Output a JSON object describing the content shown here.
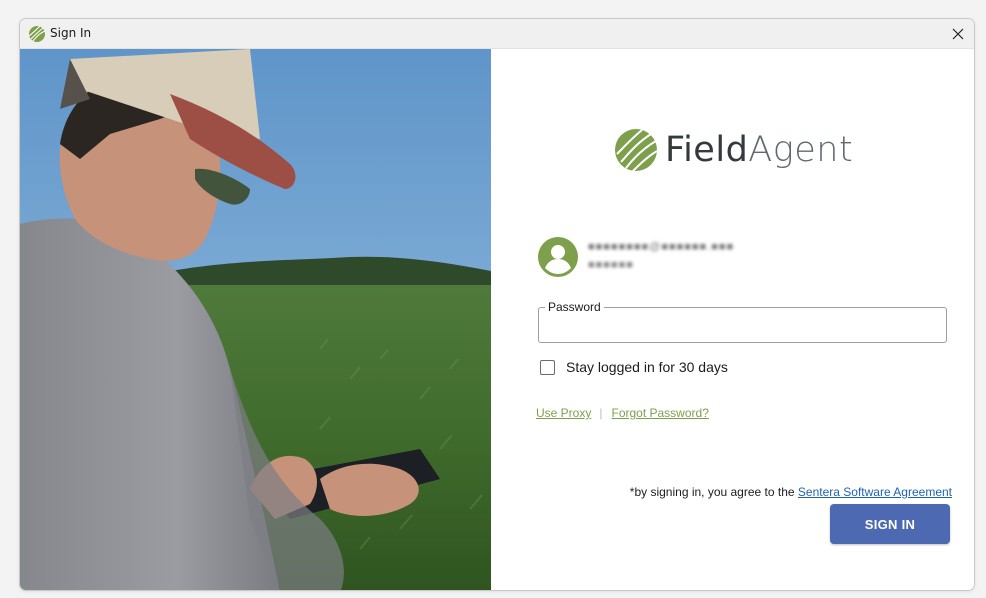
{
  "window": {
    "title": "Sign In"
  },
  "brand": {
    "name_part1": "Field",
    "name_part2": "Agent",
    "accent_color": "#7ea04d"
  },
  "user": {
    "email": "■■■■■■■■@■■■■■■.■■■",
    "name": "■■■■■■"
  },
  "login": {
    "password_label": "Password",
    "password_value": "",
    "remember_label": "Stay logged in for 30 days",
    "remember_checked": false
  },
  "links": {
    "use_proxy": "Use Proxy",
    "separator": "|",
    "forgot_password": "Forgot Password?"
  },
  "agreement": {
    "prefix": "*by signing in, you agree to the ",
    "link_text": "Sentera Software Agreement"
  },
  "actions": {
    "sign_in_label": "SIGN IN"
  },
  "icons": {
    "title_icon": "fieldagent-logo-icon",
    "close": "close-icon",
    "avatar": "user-avatar-icon"
  }
}
